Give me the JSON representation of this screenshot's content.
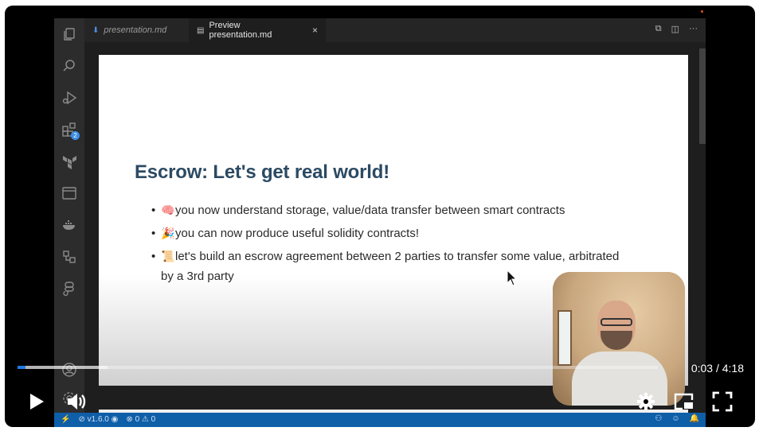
{
  "editor": {
    "tabs": [
      {
        "label": "presentation.md",
        "icon": "markdown-icon"
      },
      {
        "label": "Preview presentation.md",
        "icon": "preview-icon",
        "close": "×"
      }
    ],
    "activity_badge": "2",
    "status_bar": {
      "version": "v1.6.0",
      "errors": "0",
      "warnings": "0"
    }
  },
  "slide": {
    "title": "Escrow: Let's get real world!",
    "bullets": [
      {
        "emoji": "🧠",
        "text": "you now understand storage, value/data transfer between smart contracts"
      },
      {
        "emoji": "🎉",
        "text": "you can now produce useful solidity contracts!"
      },
      {
        "emoji": "📜",
        "text": "let's build an escrow agreement between 2 parties to transfer some value, arbitrated by a 3rd party"
      }
    ]
  },
  "player": {
    "current_time": "0:03",
    "duration": "4:18",
    "time_display": "0:03 / 4:18",
    "played_fraction": 0.012,
    "buffered_fraction": 0.14,
    "accent_color": "#1f7ae0"
  },
  "colors": {
    "title": "#2c4a63",
    "statusbar": "#0f5ea8",
    "activity_bar": "#2c2c2c"
  }
}
